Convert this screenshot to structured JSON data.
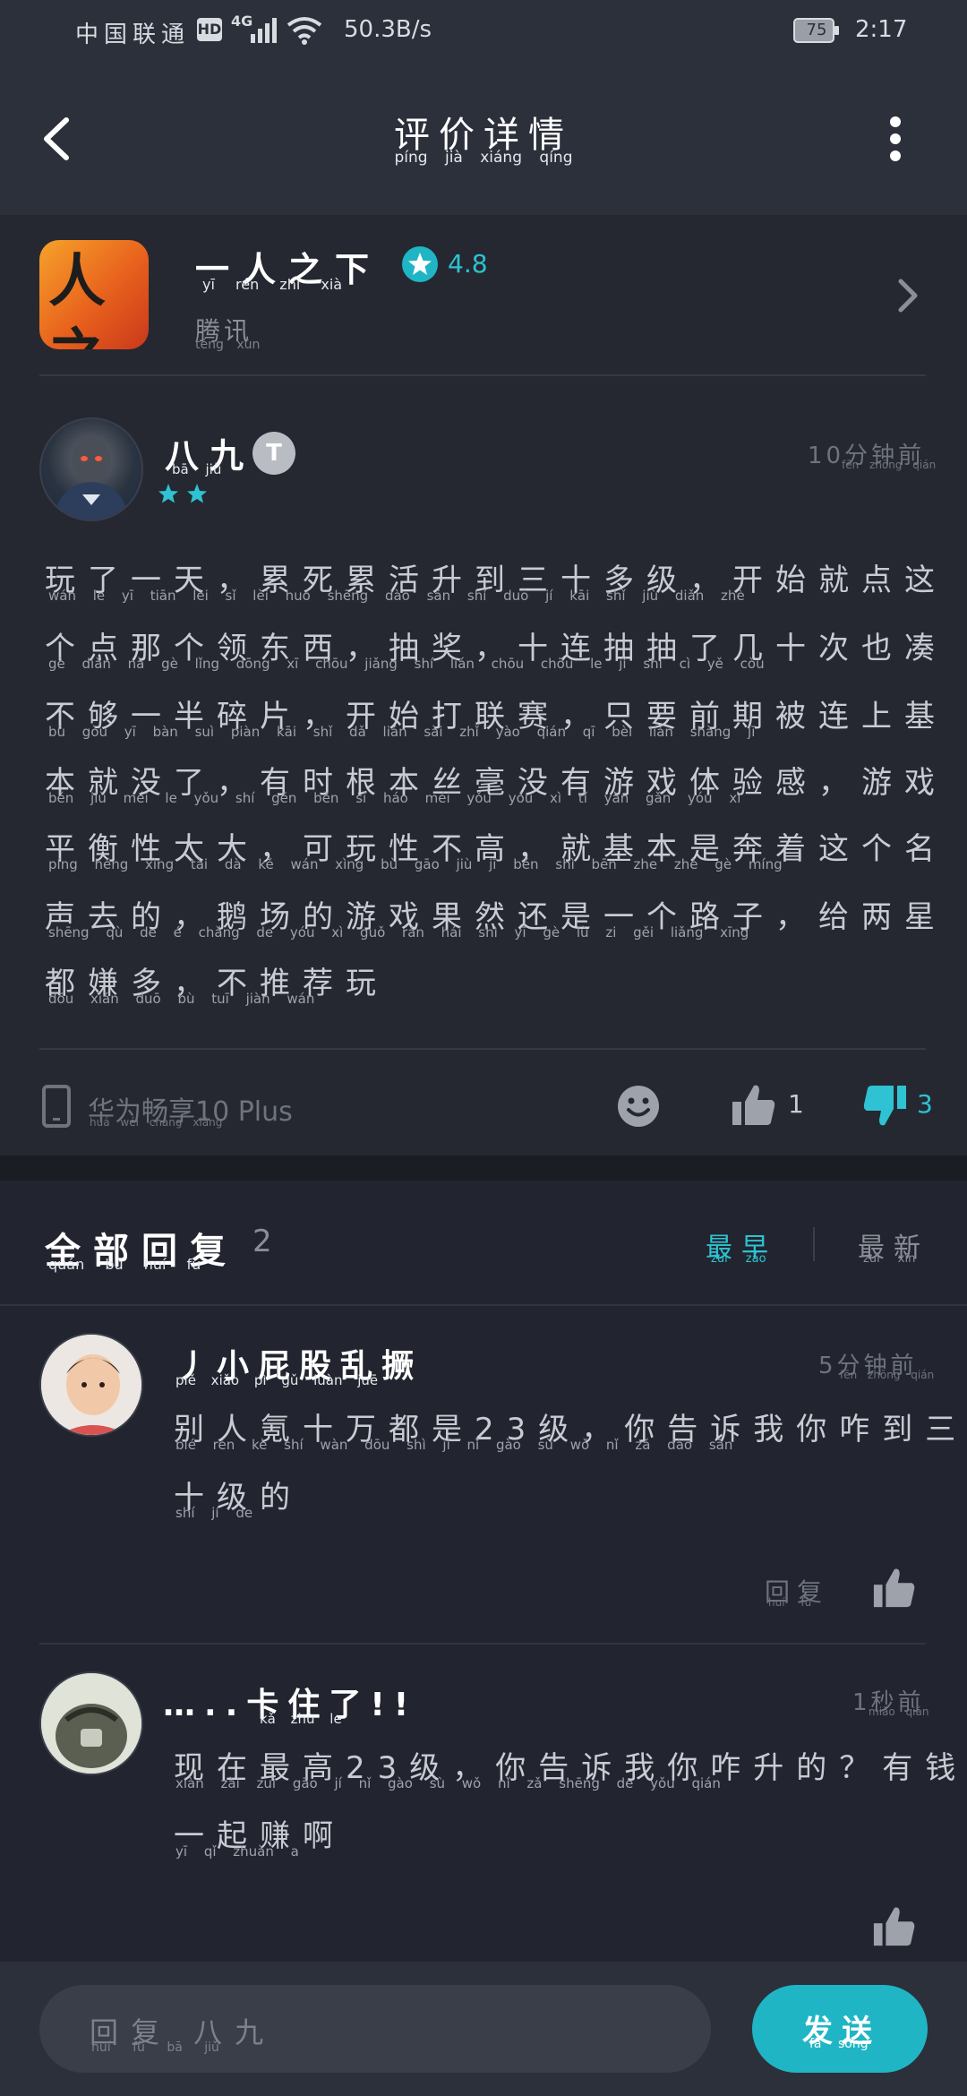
{
  "status_bar": {
    "carrier": "中国联通",
    "carrier_pinyin": "zhōng guó lián tōng",
    "hd": "HD",
    "network": "4G",
    "speed": "50.3B/s",
    "battery": "75",
    "time": "2:17"
  },
  "header": {
    "title": "评价详情",
    "title_pinyin": "píng jià xiáng qíng"
  },
  "app": {
    "name": "一人之下",
    "name_pinyin": "yī rén zhī xià",
    "rating": "4.8",
    "publisher": "腾讯",
    "publisher_pinyin": "téng xùn",
    "icon_glyph": "人之下"
  },
  "review": {
    "author": "八九",
    "author_pinyin": "bā jiǔ",
    "level": "T",
    "stars": 2,
    "time": "10分钟前",
    "time_pinyin": "fēn zhōng qián",
    "lines": [
      {
        "text": "玩了一天，累死累活升到三十多级，开始就点这",
        "pinyin": "wán le yī tiān  lèi sǐ lèi huó shēng dào sān shí duō jí  kāi shǐ jiù diǎn zhè"
      },
      {
        "text": "个点那个领东西，抽奖，十连抽抽了几十次也凑",
        "pinyin": "gè diǎn nà gè lǐng dōng xī  chōu jiǎng  shí lián chōu chōu le jǐ shí cì yě còu"
      },
      {
        "text": "不够一半碎片，开始打联赛，只要前期被连上基",
        "pinyin": "bù gòu yī bàn suì piàn  kāi shǐ dǎ lián sài  zhǐ yào qián qī bèi lián shàng jī"
      },
      {
        "text": "本就没了，有时根本丝毫没有游戏体验感，游戏",
        "pinyin": "běn jiù méi le  yǒu shí gēn běn sī háo méi yǒu yóu xì tǐ yàn gǎn  yóu xì"
      },
      {
        "text": "平衡性太大，可玩性不高，就基本是奔着这个名",
        "pinyin": "píng héng xìng tài dà  kě wán xìng bù gāo  jiù jī běn shì bēn zhe zhè gè míng"
      },
      {
        "text": "声去的，鹅场的游戏果然还是一个路子，给两星",
        "pinyin": "shēng qù de  é chǎng de yóu xì guǒ rán hái shì yī gè lù zi  gěi liǎng xīng"
      },
      {
        "text": "都嫌多，不推荐玩",
        "pinyin": "dōu xián duō  bù tuī jiàn wán"
      }
    ],
    "device": "华为畅享10 Plus",
    "device_pinyin": "huá wéi chàng xiǎng",
    "likes": "1",
    "dislikes": "3"
  },
  "replies": {
    "title": "全部回复",
    "title_pinyin": "quán bù huí fù",
    "count": "2",
    "sort_earliest": "最早",
    "sort_earliest_pinyin": "zuì zǎo",
    "sort_latest": "最新",
    "sort_latest_pinyin": "zuì xīn",
    "items": [
      {
        "name": "丿小屁股乱撅",
        "name_pinyin": "piě xiǎo pì gǔ luàn juē",
        "time": "5分钟前",
        "time_pinyin": "fēn zhōng qián",
        "line1": "别人氪十万都是23级，你告诉我你咋到三",
        "line1_pinyin": "bié rén kè shí wàn dōu shì   jí   nǐ gào sù wǒ nǐ zǎ dào sān",
        "line2": "十级的",
        "line2_pinyin": "shí jí de",
        "respond": "回复",
        "respond_pinyin": "huí fù"
      },
      {
        "name": "…..卡住了!!",
        "name_pinyin": "kǎ zhù le",
        "time": "1秒前",
        "time_pinyin": "miǎo qián",
        "line1": "现在最高23级，你告诉我你咋升的？有钱",
        "line1_pinyin": "xiàn zài zuì gāo   jí   nǐ gào sù wǒ nǐ zǎ shēng de   yǒu qián",
        "line2": "一起赚啊",
        "line2_pinyin": "yī qǐ zhuàn a"
      }
    ]
  },
  "reply_bar": {
    "placeholder": "回复 八九",
    "placeholder_pinyin": "huí fù bā jiǔ",
    "send": "发送",
    "send_pinyin": "fā sòng"
  },
  "colors": {
    "accent": "#2ec2d2",
    "background": "#22252f",
    "header": "#2c303a"
  },
  "icons": [
    "back-arrow",
    "more-vertical",
    "star",
    "chevron-right",
    "phone",
    "smiley",
    "thumbs-up",
    "thumbs-down",
    "signal",
    "wifi",
    "battery"
  ]
}
